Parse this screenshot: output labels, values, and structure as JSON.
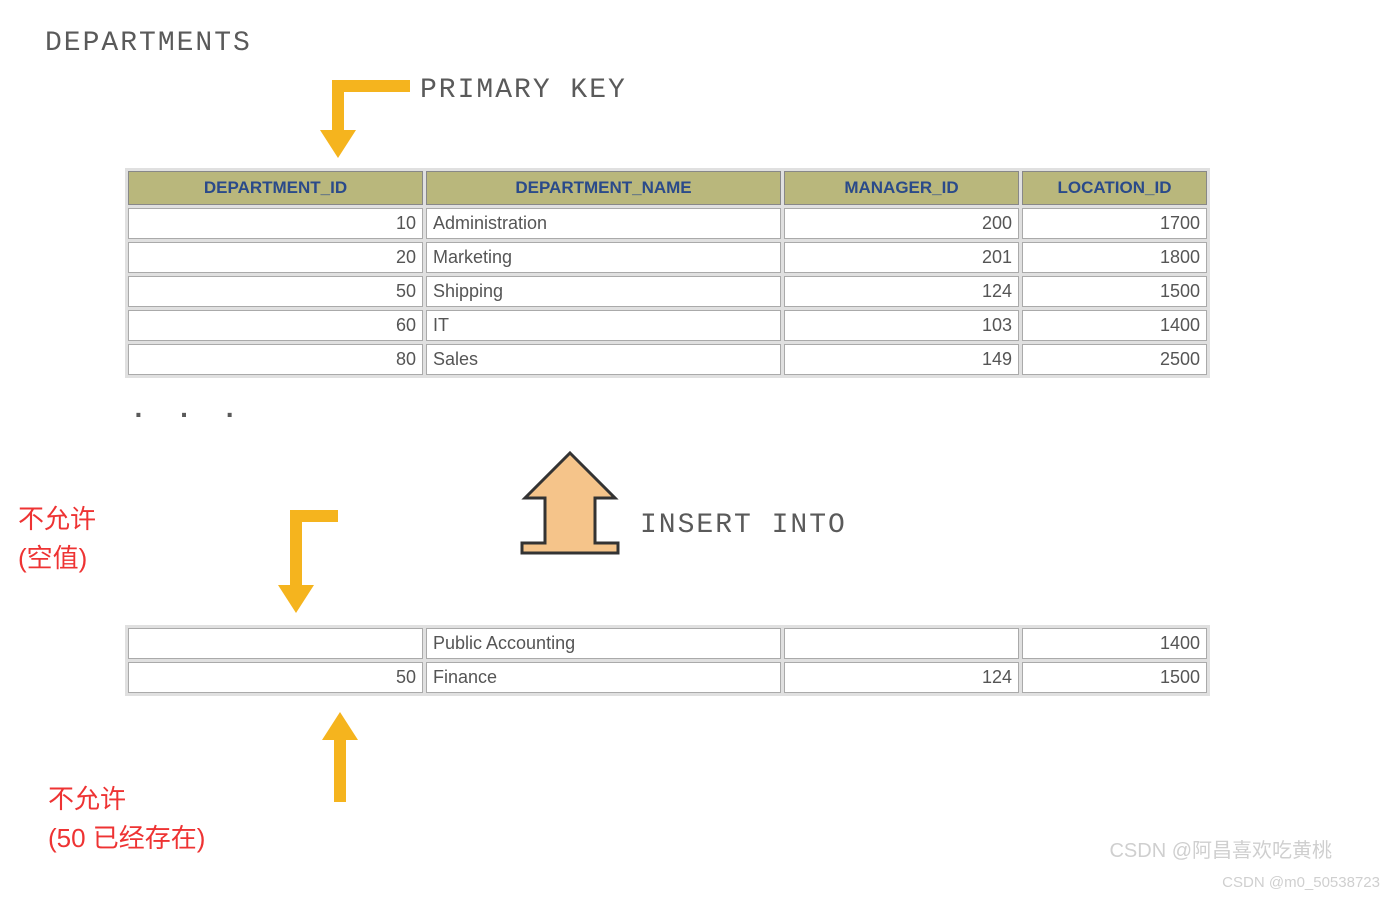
{
  "title": "DEPARTMENTS",
  "pk_label": "PRIMARY KEY",
  "insert_label": "INSERT INTO",
  "ellipsis": ". . .",
  "headers": {
    "dept_id": "DEPARTMENT_ID",
    "dept_name": "DEPARTMENT_NAME",
    "mgr_id": "MANAGER_ID",
    "loc_id": "LOCATION_ID"
  },
  "rows": [
    {
      "dept_id": "10",
      "dept_name": "Administration",
      "mgr_id": "200",
      "loc_id": "1700"
    },
    {
      "dept_id": "20",
      "dept_name": "Marketing",
      "mgr_id": "201",
      "loc_id": "1800"
    },
    {
      "dept_id": "50",
      "dept_name": "Shipping",
      "mgr_id": "124",
      "loc_id": "1500"
    },
    {
      "dept_id": "60",
      "dept_name": "IT",
      "mgr_id": "103",
      "loc_id": "1400"
    },
    {
      "dept_id": "80",
      "dept_name": "Sales",
      "mgr_id": "149",
      "loc_id": "2500"
    }
  ],
  "insert_rows": [
    {
      "dept_id": "",
      "dept_name": "Public Accounting",
      "mgr_id": "",
      "loc_id": "1400"
    },
    {
      "dept_id": "50",
      "dept_name": "Finance",
      "mgr_id": "124",
      "loc_id": "1500"
    }
  ],
  "labels": {
    "not_allowed_null_1": "不允许",
    "not_allowed_null_2": "(空值)",
    "not_allowed_dup_1": "不允许",
    "not_allowed_dup_2": "(50 已经存在)"
  },
  "watermark1": "CSDN @阿昌喜欢吃黄桃",
  "watermark2": "CSDN @m0_50538723"
}
